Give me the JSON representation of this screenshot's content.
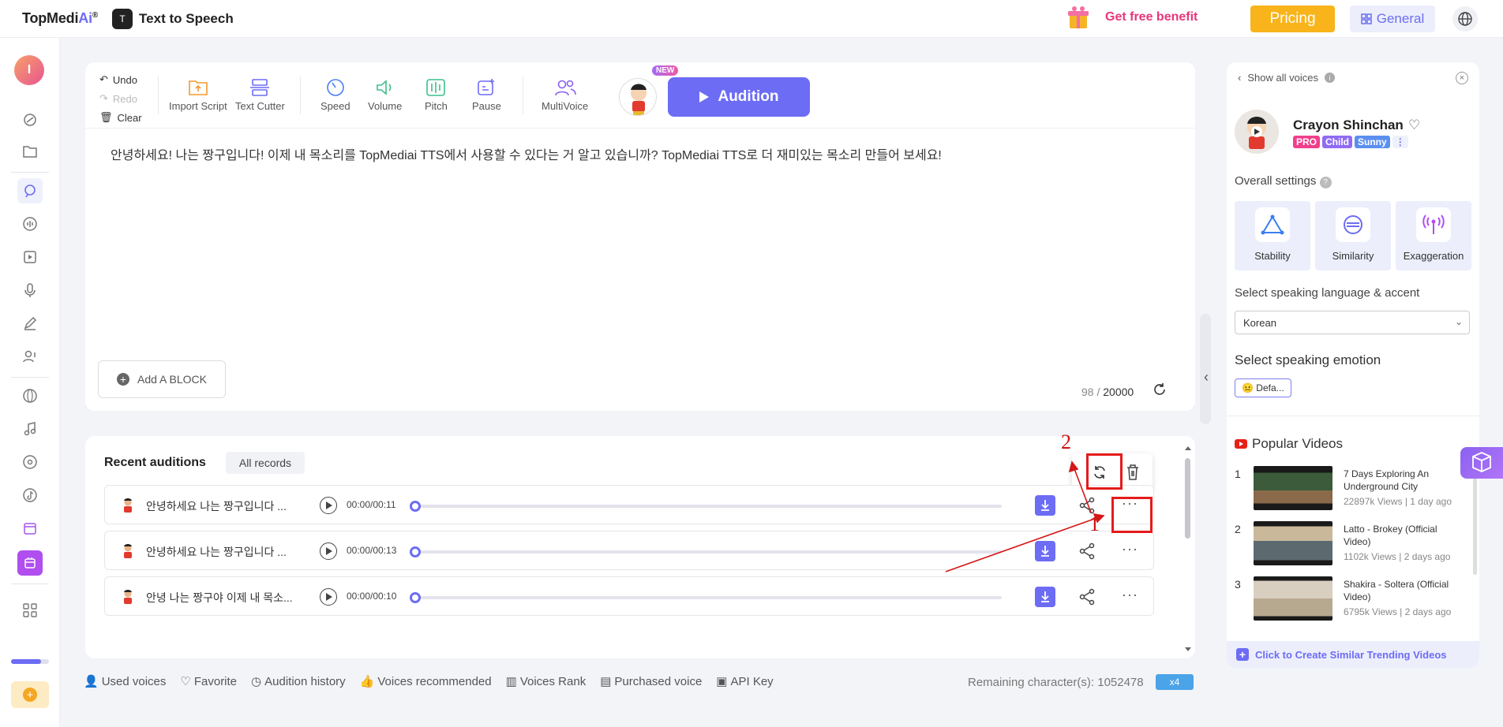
{
  "header": {
    "logo_text": "TopMedi",
    "logo_ai": "Ai",
    "logo_reg": "®",
    "app_badge": "T",
    "app_title": "Text to Speech",
    "free_benefit": "Get free benefit",
    "pricing": "Pricing",
    "general": "General"
  },
  "sidebar": {
    "avatar_letter": "I"
  },
  "toolbar": {
    "undo": "Undo",
    "redo": "Redo",
    "clear": "Clear",
    "import_script": "Import Script",
    "text_cutter": "Text Cutter",
    "speed": "Speed",
    "volume": "Volume",
    "pitch": "Pitch",
    "pause": "Pause",
    "multivoice": "MultiVoice",
    "new_badge": "NEW",
    "audition": "Audition"
  },
  "editor": {
    "script": "안녕하세요! 나는 짱구입니다! 이제 내 목소리를 TopMediai TTS에서 사용할 수 있다는 거 알고 있습니까? TopMediai TTS로 더 재미있는 목소리 만들어 보세요!",
    "add_block": "Add A BLOCK",
    "char_count": "98",
    "char_sep": " / ",
    "char_limit": "20000"
  },
  "recent": {
    "title": "Recent auditions",
    "all_records": "All records",
    "rows": [
      {
        "text": "안녕하세요 나는 짱구입니다 ...",
        "time": "00:00/00:11",
        "progress": 0
      },
      {
        "text": "안녕하세요 나는 짱구입니다 ...",
        "time": "00:00/00:13",
        "progress": 0
      },
      {
        "text": "안녕 나는 짱구야 이제 내 목소...",
        "time": "00:00/00:10",
        "progress": 0
      }
    ],
    "more_glyph": "···"
  },
  "annotations": {
    "label_1": "1",
    "label_2": "2"
  },
  "footer": {
    "used_voices": "Used voices",
    "favorite": "Favorite",
    "audition_history": "Audition history",
    "voices_recommended": "Voices recommended",
    "voices_rank": "Voices Rank",
    "purchased_voice": "Purchased voice",
    "api_key": "API Key",
    "remaining": "Remaining character(s): 1052478",
    "multiplier": "x4"
  },
  "right_panel": {
    "show_all_voices": "Show all voices",
    "voice_name": "Crayon Shinchan",
    "tags": [
      "PRO",
      "Child",
      "Sunny"
    ],
    "tag_colors": [
      "#f03f8c",
      "#8f6cf2",
      "#5a8ff0"
    ],
    "overall_settings": "Overall settings",
    "settings": [
      "Stability",
      "Similarity",
      "Exaggeration"
    ],
    "language_label": "Select speaking language & accent",
    "language_value": "Korean",
    "emotion_label": "Select speaking emotion",
    "emotion_value": "Defa...",
    "popular_videos": "Popular Videos",
    "videos": [
      {
        "num": "1",
        "title": "7 Days Exploring An Underground City",
        "meta": "22897k Views | 1 day ago"
      },
      {
        "num": "2",
        "title": "Latto - Brokey (Official Video)",
        "meta": "1102k Views | 2 days ago"
      },
      {
        "num": "3",
        "title": "Shakira - Soltera (Official Video)",
        "meta": "6795k Views | 2 days ago"
      }
    ],
    "create_similar": "Click to Create Similar Trending Videos"
  },
  "colors": {
    "accent": "#6d6cf5",
    "pricing": "#f8b41a",
    "annotation": "#e51b1b"
  }
}
